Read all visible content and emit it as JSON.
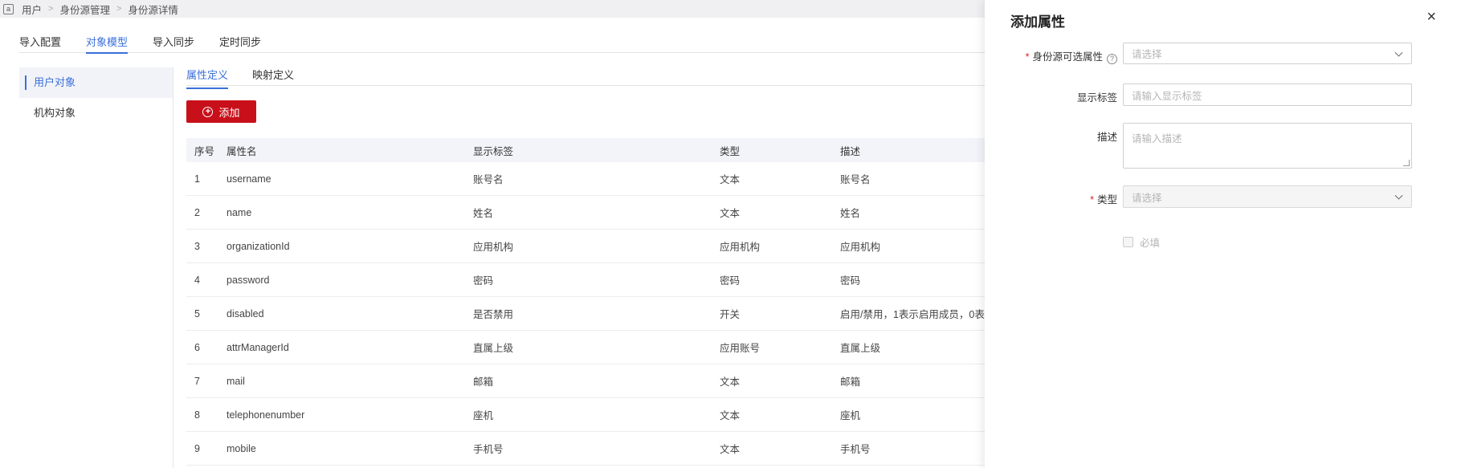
{
  "breadcrumb": {
    "home_icon": "home-box-icon",
    "items": [
      "用户",
      "身份源管理",
      "身份源详情"
    ]
  },
  "top_tabs": [
    "导入配置",
    "对象模型",
    "导入同步",
    "定时同步"
  ],
  "top_tabs_active": "对象模型",
  "left_menu": [
    "用户对象",
    "机构对象"
  ],
  "sub_tabs": [
    "属性定义",
    "映射定义"
  ],
  "add_button": {
    "label": "添加",
    "icon": "plus-circle-icon",
    "color": "#c8101a"
  },
  "table": {
    "headers": [
      "序号",
      "属性名",
      "显示标签",
      "类型",
      "描述"
    ],
    "rows": [
      [
        "1",
        "username",
        "账号名",
        "文本",
        "账号名"
      ],
      [
        "2",
        "name",
        "姓名",
        "文本",
        "姓名"
      ],
      [
        "3",
        "organizationId",
        "应用机构",
        "应用机构",
        "应用机构"
      ],
      [
        "4",
        "password",
        "密码",
        "密码",
        "密码"
      ],
      [
        "5",
        "disabled",
        "是否禁用",
        "开关",
        "启用/禁用，1表示启用成员，0表"
      ],
      [
        "6",
        "attrManagerId",
        "直属上级",
        "应用账号",
        "直属上级"
      ],
      [
        "7",
        "mail",
        "邮箱",
        "文本",
        "邮箱"
      ],
      [
        "8",
        "telephonenumber",
        "座机",
        "文本",
        "座机"
      ],
      [
        "9",
        "mobile",
        "手机号",
        "文本",
        "手机号"
      ]
    ]
  },
  "drawer": {
    "title": "添加属性",
    "close": "×",
    "fields": {
      "source_attr": {
        "label": "身份源可选属性",
        "placeholder": "请选择",
        "help": "?"
      },
      "display_label": {
        "label": "显示标签",
        "placeholder": "请输入显示标签"
      },
      "description": {
        "label": "描述",
        "placeholder": "请输入描述"
      },
      "type": {
        "label": "类型",
        "placeholder": "请选择"
      },
      "required": {
        "label": "必填"
      }
    },
    "required_mark": "*"
  },
  "colors": {
    "accent": "#3a6fd8",
    "brand": "#c8101a",
    "required": "#d9261c"
  }
}
